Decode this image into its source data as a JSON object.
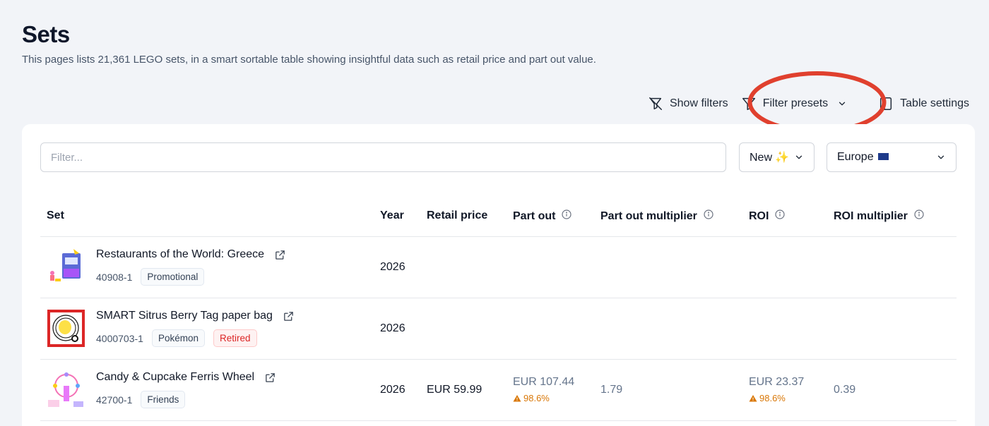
{
  "page": {
    "title": "Sets",
    "subtitle": "This pages lists 21,361 LEGO sets, in a smart sortable table showing insightful data such as retail price and part out value."
  },
  "toolbar": {
    "show_filters": "Show filters",
    "filter_presets": "Filter presets",
    "table_settings": "Table settings"
  },
  "filters": {
    "placeholder": "Filter...",
    "sort_value": "New",
    "region_value": "Europe"
  },
  "table": {
    "headers": {
      "set": "Set",
      "year": "Year",
      "retail": "Retail price",
      "part_out": "Part out",
      "part_out_multiplier": "Part out multiplier",
      "roi": "ROI",
      "roi_multiplier": "ROI multiplier"
    },
    "rows": [
      {
        "name": "Restaurants of the World: Greece",
        "number": "40908-1",
        "badges": [
          "Promotional"
        ],
        "year": "2026",
        "retail": "",
        "part_out": "",
        "part_out_warn": "",
        "pom": "",
        "roi": "",
        "roi_warn": "",
        "roim": ""
      },
      {
        "name": "SMART Sitrus Berry Tag paper bag",
        "number": "4000703-1",
        "badges": [
          "Pokémon",
          "Retired"
        ],
        "year": "2026",
        "retail": "",
        "part_out": "",
        "part_out_warn": "",
        "pom": "",
        "roi": "",
        "roi_warn": "",
        "roim": ""
      },
      {
        "name": "Candy & Cupcake Ferris Wheel",
        "number": "42700-1",
        "badges": [
          "Friends"
        ],
        "year": "2026",
        "retail": "EUR 59.99",
        "part_out": "EUR 107.44",
        "part_out_warn": "98.6%",
        "pom": "1.79",
        "roi": "EUR 23.37",
        "roi_warn": "98.6%",
        "roim": "0.39"
      }
    ]
  },
  "colors": {
    "background": "#f2f4f8",
    "highlight": "#e0402e",
    "warning": "#d97706",
    "retired": "#dc2626"
  }
}
